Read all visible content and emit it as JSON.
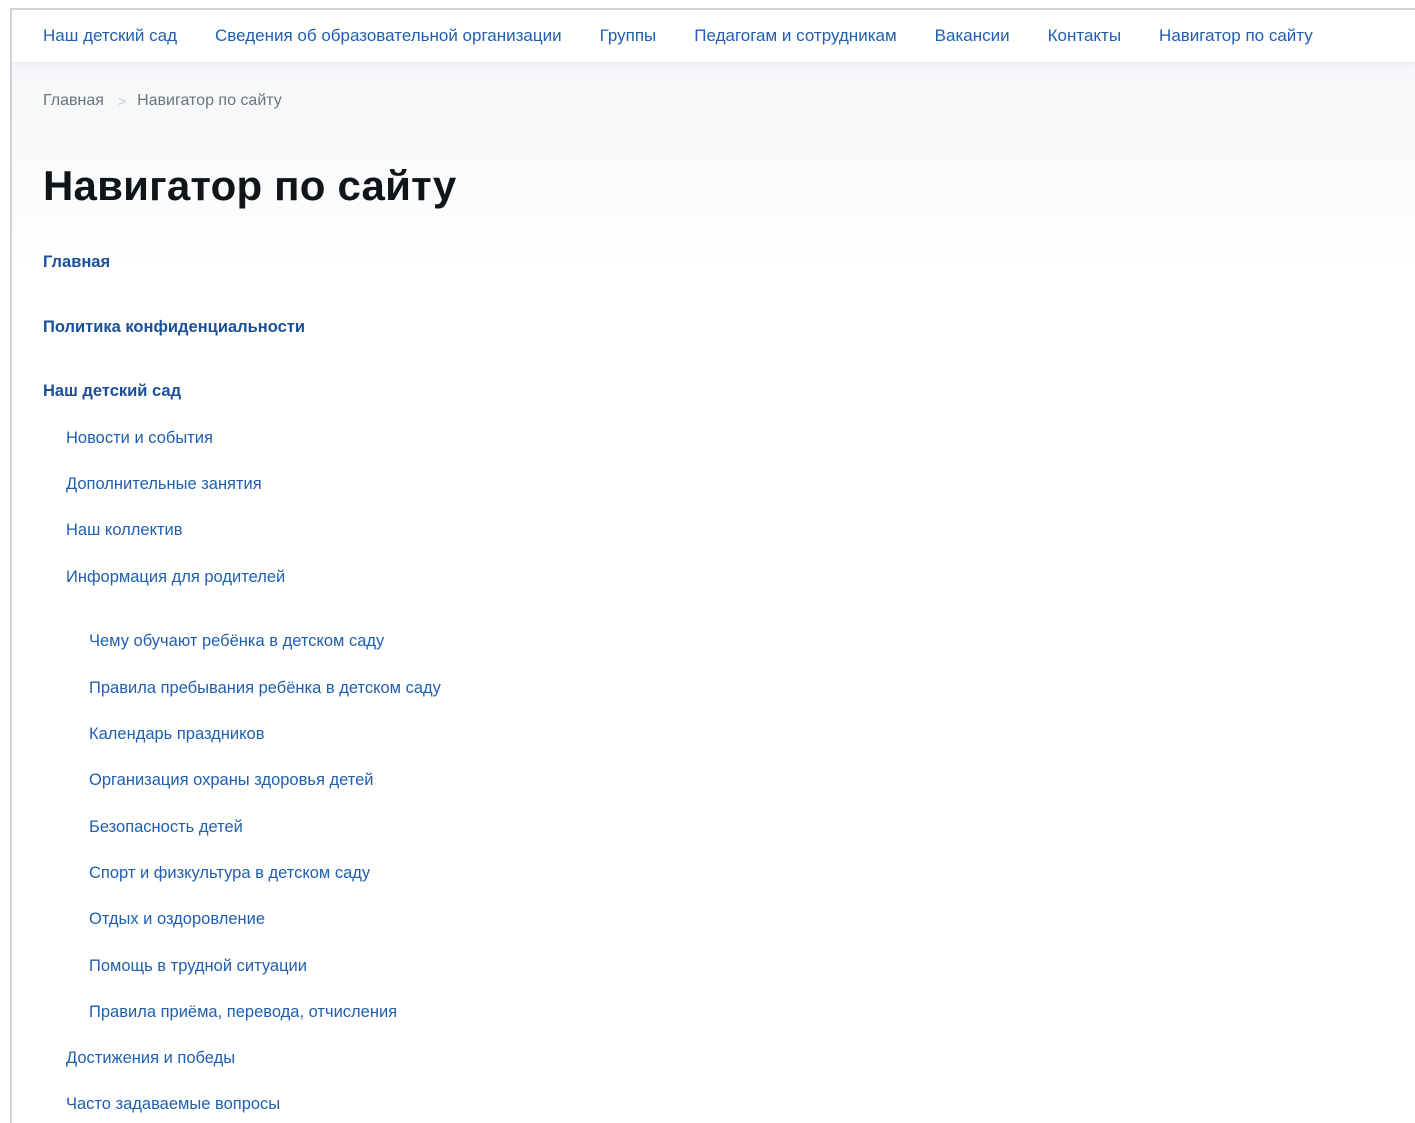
{
  "topnav": {
    "items": [
      "Наш детский сад",
      "Сведения об образовательной организации",
      "Группы",
      "Педагогам и сотрудникам",
      "Вакансии",
      "Контакты",
      "Навигатор по сайту"
    ]
  },
  "breadcrumb": {
    "home": "Главная",
    "separator": ">",
    "current": "Навигатор по сайту"
  },
  "page_title": "Навигатор по сайту",
  "sitemap": {
    "main": "Главная",
    "privacy": "Политика конфиденциальности",
    "kindergarten": {
      "title": "Наш детский сад",
      "children": [
        "Новости и события",
        "Дополнительные занятия",
        "Наш коллектив",
        "Информация для родителей"
      ],
      "parents_info_children": [
        "Чему обучают ребёнка в детском саду",
        "Правила пребывания ребёнка в детском саду",
        "Календарь праздников",
        "Организация охраны здоровья детей",
        "Безопасность детей",
        "Спорт и физкультура в детском саду",
        "Отдых и оздоровление",
        "Помощь в трудной ситуации",
        "Правила приёма, перевода, отчисления"
      ],
      "more_children": [
        "Достижения и победы",
        "Часто задаваемые вопросы"
      ]
    }
  },
  "colors": {
    "link": "#1f5fb0",
    "heading": "#111418",
    "muted": "#6b7480"
  }
}
